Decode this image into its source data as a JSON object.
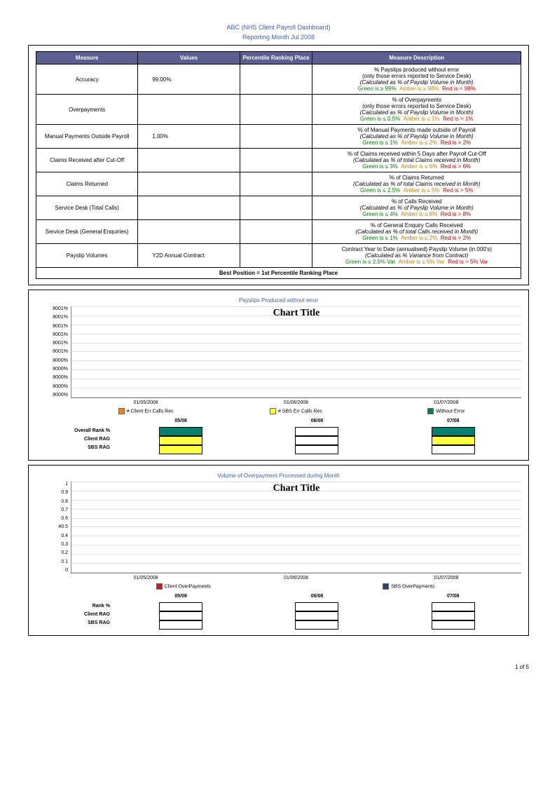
{
  "header": {
    "title": "ABC (NHS Client Payroll Dashboard)",
    "subtitle": "Reporting Month Jul 2008"
  },
  "table": {
    "cols": [
      "Measure",
      "Values",
      "Percentile Ranking Place",
      "Measure Description"
    ],
    "rows": [
      {
        "measure": "Accuracy",
        "value": "99.00%",
        "desc": "% Payslips produced without error",
        "desc2": "(only those errors reported to Service Desk)",
        "calc": "(Calculated as % of Payslip Volume in Month)",
        "g": "Green is ≥ 99%",
        "a": "Amber is ≥ 98%",
        "r": "Red is < 98%"
      },
      {
        "measure": "Overpayments",
        "value": "",
        "desc": "% of Overpayments",
        "desc2": "(only those errors reported to Service Desk)",
        "calc": "(Calculated as % of Payslip Volume in Month)",
        "g": "Green is ≤ 0.5%",
        "a": "Amber is ≤ 1%",
        "r": "Red is > 1%"
      },
      {
        "measure": "Manual Payments Outside Payroll",
        "value": "1.00%",
        "desc": "% of Manual Payments made outside of Payroll",
        "desc2": "",
        "calc": "(Calculated as % of Payslip Volume in Month)",
        "g": "Green is ≤ 1%",
        "a": "Amber is ≤ 2%",
        "r": "Red is > 2%"
      },
      {
        "measure": "Claims Received after Cut-Off",
        "value": "",
        "desc": "% of Claims received within 5 Days after Payroll Cut-Off",
        "desc2": "",
        "calc": "(Calculated as % of total Claims received in Month)",
        "g": "Green is ≤ 3%",
        "a": "Amber is ≤ 6%",
        "r": "Red is > 6%"
      },
      {
        "measure": "Claims Returned",
        "value": "",
        "desc": "% of Claims Returned",
        "desc2": "",
        "calc": "(Calculated as % of total Claims received in Month)",
        "g": "Green is ≤ 2.5%",
        "a": "Amber is ≤ 5%",
        "r": "Red is > 5%"
      },
      {
        "measure": "Service Desk (Total Calls)",
        "value": "",
        "desc": "% of Calls Received",
        "desc2": "",
        "calc": "(Calculated as % of Payslip Volume in Month)",
        "g": "Green is ≤ 4%",
        "a": "Amber is ≤ 8%",
        "r": "Red is > 8%"
      },
      {
        "measure": "Service Desk (General Enquiries)",
        "value": "",
        "desc": "% of General Enquiry Calls Received",
        "desc2": "",
        "calc": "(Calculated as % of total Calls received in Month)",
        "g": "Green is ≤ 1%",
        "a": "Amber is ≤ 2%",
        "r": "Red is > 2%"
      },
      {
        "measure": "Payslip Volumes",
        "value": "Y2D Annual           Contract",
        "desc": "Contract Year to Date (annualised) Payslip Volume (in 000's)",
        "desc2": "",
        "calc": "(Calculated as % Variance from Contract)",
        "g": "Green is ≤ 2.5% Var",
        "a": "Amber is ≤ 5% Var",
        "r": "Red is > 5% Var"
      }
    ],
    "footer": "Best Position = 1st Percentile Ranking Place"
  },
  "chart1": {
    "panelTitle": "Payslips Produced without error",
    "innerTitle": "Chart Title",
    "yTicks": [
      "8001%",
      "8001%",
      "8001%",
      "8001%",
      "8001%",
      "8001%",
      "8000%",
      "8000%",
      "8000%",
      "8000%",
      "8000%"
    ],
    "xTicks": [
      "01/05/2008",
      "01/06/2008",
      "01/07/2008"
    ],
    "legend": [
      {
        "color": "#f08020",
        "label": "# Client Err Calls Rec"
      },
      {
        "color": "#ffff40",
        "label": "# SBS Err Calls Rec"
      },
      {
        "color": "#00805a",
        "label": "Without Error"
      }
    ],
    "rankHeads": [
      "05/08",
      "06/08",
      "07/08"
    ],
    "rankLabels": [
      "Overall Rank %",
      "Client RAG",
      "SBS RAG"
    ],
    "rankFills": [
      [
        "#008070",
        "#ffff40",
        "#ffff40"
      ],
      [
        "#ffffff",
        "#ffffff",
        "#ffffff"
      ],
      [
        "#008070",
        "#ffff40",
        "#ffffff"
      ]
    ]
  },
  "chart2": {
    "panelTitle": "Volume of Overpayment Processed during Month",
    "innerTitle": "Chart Title",
    "yTicks": [
      "1",
      "0.9",
      "0.8",
      "0.7",
      "0.6",
      "#0.5",
      "0.4",
      "0.3",
      "0.2",
      "0.1",
      "0"
    ],
    "xTicks": [
      "01/05/2008",
      "01/06/2008",
      "01/07/2008"
    ],
    "legend": [
      {
        "color": "#c02020",
        "label": "Client OverPayments"
      },
      {
        "color": "#304070",
        "label": "SBS OverPayments"
      }
    ],
    "rankHeads": [
      "05/08",
      "06/08",
      "07/08"
    ],
    "rankLabels": [
      "Rank %",
      "Client RAG",
      "SBS RAG"
    ],
    "rankFills": [
      [
        "#ffffff",
        "#ffffff",
        "#ffffff"
      ],
      [
        "#ffffff",
        "#ffffff",
        "#ffffff"
      ],
      [
        "#ffffff",
        "#ffffff",
        "#ffffff"
      ]
    ]
  },
  "footer": {
    "page": "1 of 5"
  },
  "chart_data": [
    {
      "type": "bar",
      "title": "Payslips Produced without error",
      "categories": [
        "01/05/2008",
        "01/06/2008",
        "01/07/2008"
      ],
      "series": [
        {
          "name": "# Client Err Calls Rec",
          "values": [
            null,
            null,
            null
          ]
        },
        {
          "name": "# SBS Err Calls Rec",
          "values": [
            null,
            null,
            null
          ]
        },
        {
          "name": "Without Error",
          "values": [
            null,
            null,
            null
          ]
        }
      ],
      "ylim": [
        8000,
        8001
      ]
    },
    {
      "type": "bar",
      "title": "Volume of Overpayment Processed during Month",
      "categories": [
        "01/05/2008",
        "01/06/2008",
        "01/07/2008"
      ],
      "series": [
        {
          "name": "Client OverPayments",
          "values": [
            null,
            null,
            null
          ]
        },
        {
          "name": "SBS OverPayments",
          "values": [
            null,
            null,
            null
          ]
        }
      ],
      "ylim": [
        0,
        1
      ]
    }
  ]
}
